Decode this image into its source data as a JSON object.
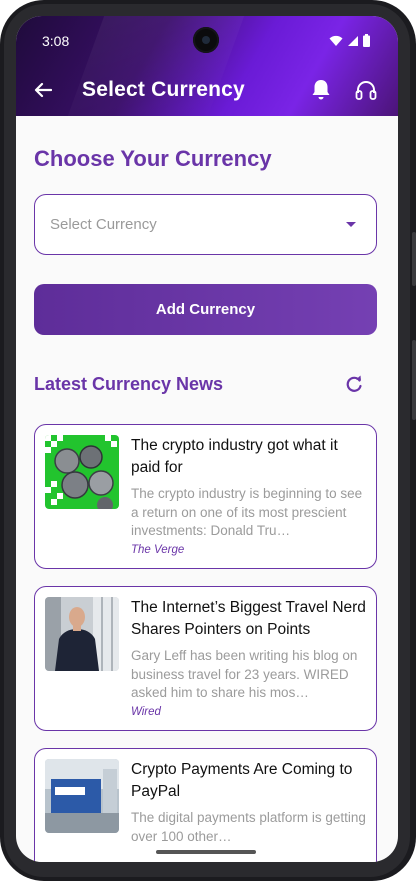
{
  "status_bar": {
    "time": "3:08"
  },
  "header": {
    "title": "Select Currency"
  },
  "content": {
    "heading": "Choose Your Currency",
    "select": {
      "placeholder": "Select Currency"
    },
    "add_button": "Add Currency",
    "news_heading": "Latest Currency News"
  },
  "news": [
    {
      "title": "The crypto industry got what it paid for",
      "description": "The crypto industry is beginning to see a return on one of its most prescient investments: Donald Tru…",
      "source": "The Verge"
    },
    {
      "title": "The Internet’s Biggest Travel Nerd Shares Pointers on Points",
      "description": "Gary Leff has been writing his blog on business travel for 23 years. WIRED asked him to share his mos…",
      "source": "Wired"
    },
    {
      "title": "Crypto Payments Are Coming to PayPal",
      "description": "The digital payments platform is getting over 100 other…",
      "source": ""
    }
  ],
  "colors": {
    "accent": "#6a35a8",
    "header_gradient_start": "#1f0b3b",
    "header_gradient_end": "#7a24e6"
  },
  "icons": [
    "back-arrow-icon",
    "bell-icon",
    "headset-icon",
    "refresh-icon",
    "wifi-icon",
    "signal-icon",
    "battery-icon",
    "dropdown-caret-icon"
  ]
}
